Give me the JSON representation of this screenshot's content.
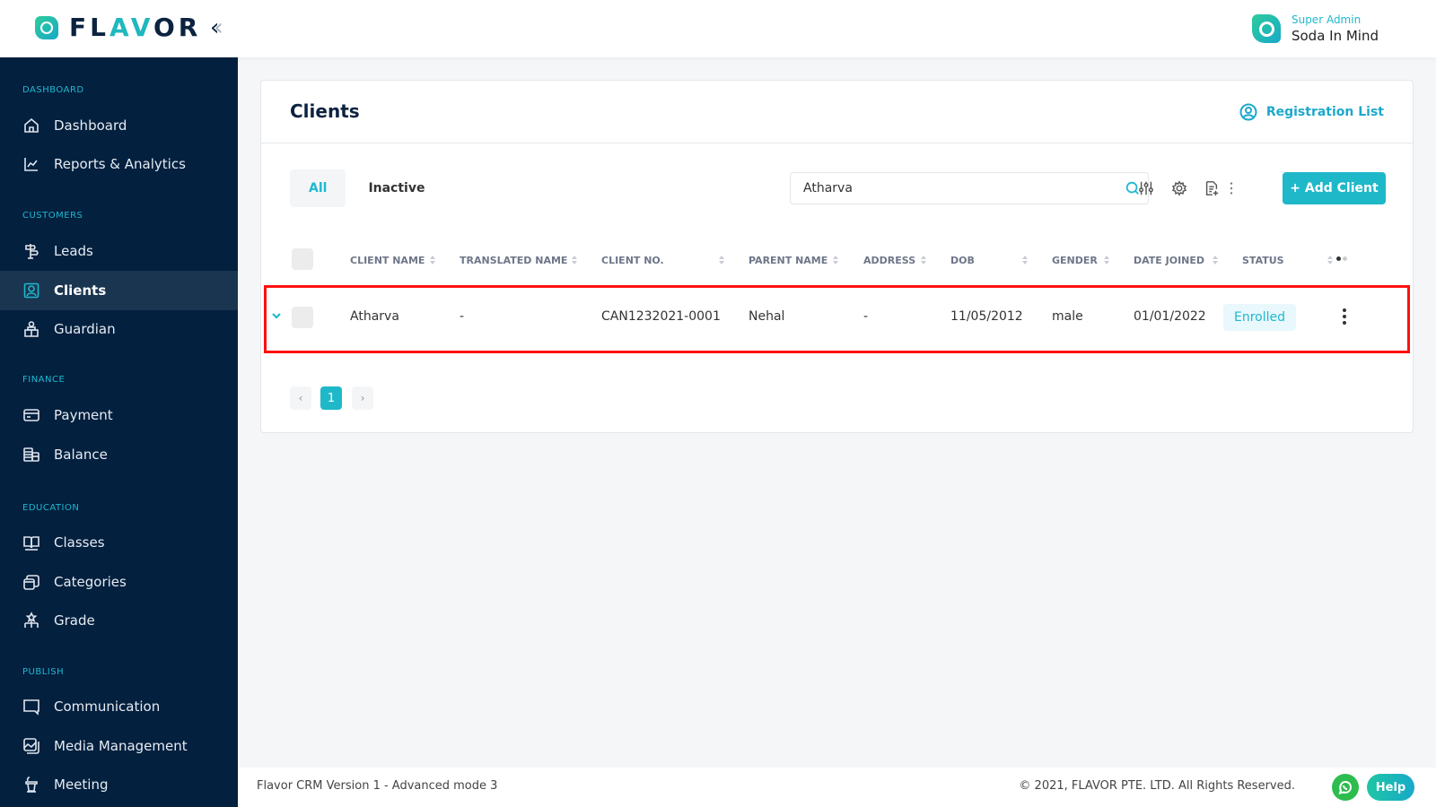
{
  "app": {
    "brand": "FLAVOR",
    "brand_parts": [
      "FL",
      "A",
      "V",
      "OR"
    ],
    "collapse_icon": "double-chevron-left-icon"
  },
  "user": {
    "role": "Super Admin",
    "name": "Soda In Mind"
  },
  "sidebar": {
    "sections": [
      {
        "label": "DASHBOARD",
        "items": [
          {
            "label": "Dashboard",
            "icon": "home-icon"
          },
          {
            "label": "Reports & Analytics",
            "icon": "chart-line-icon"
          }
        ]
      },
      {
        "label": "CUSTOMERS",
        "items": [
          {
            "label": "Leads",
            "icon": "signpost-icon"
          },
          {
            "label": "Clients",
            "icon": "user-square-icon",
            "active": true
          },
          {
            "label": "Guardian",
            "icon": "guardian-icon"
          }
        ]
      },
      {
        "label": "FINANCE",
        "items": [
          {
            "label": "Payment",
            "icon": "credit-card-icon"
          },
          {
            "label": "Balance",
            "icon": "database-stack-icon"
          }
        ]
      },
      {
        "label": "EDUCATION",
        "items": [
          {
            "label": "Classes",
            "icon": "book-open-icon"
          },
          {
            "label": "Categories",
            "icon": "layers-icon"
          },
          {
            "label": "Grade",
            "icon": "hierarchy-icon"
          }
        ]
      },
      {
        "label": "PUBLISH",
        "items": [
          {
            "label": "Communication",
            "icon": "chat-icon"
          },
          {
            "label": "Media Management",
            "icon": "image-gallery-icon"
          },
          {
            "label": "Meeting",
            "icon": "podium-icon"
          }
        ]
      }
    ]
  },
  "page": {
    "title": "Clients",
    "registration_link": "Registration List",
    "tabs": [
      {
        "label": "All",
        "active": true
      },
      {
        "label": "Inactive",
        "active": false
      }
    ],
    "search": {
      "value": "Atharva",
      "placeholder": "Search"
    },
    "toolbar": {
      "filter_icon": "sliders-icon",
      "settings_icon": "gear-icon",
      "export_icon": "file-export-icon",
      "more_icon": "more-vertical-icon",
      "add_label": "+ Add Client"
    }
  },
  "table": {
    "columns": [
      "CLIENT NAME",
      "TRANSLATED NAME",
      "CLIENT NO.",
      "PARENT NAME",
      "ADDRESS",
      "DOB",
      "GENDER",
      "DATE JOINED",
      "STATUS"
    ],
    "rows": [
      {
        "client_name": "Atharva",
        "translated_name": "-",
        "client_no": "CAN1232021-0001",
        "parent_name": "Nehal",
        "address": "-",
        "dob": "11/05/2012",
        "gender": "male",
        "date_joined": "01/01/2022",
        "status": "Enrolled"
      }
    ]
  },
  "pagination": {
    "prev": "‹",
    "pages": [
      "1"
    ],
    "current": "1",
    "next": "›"
  },
  "footer": {
    "version": "Flavor CRM Version 1 - Advanced mode 3",
    "copyright": "© 2021, FLAVOR PTE. LTD. All Rights Reserved.",
    "help": "Help"
  },
  "colors": {
    "accent": "#1fb8c9",
    "sidebar_bg": "#03203f",
    "highlight": "#ff1010"
  }
}
